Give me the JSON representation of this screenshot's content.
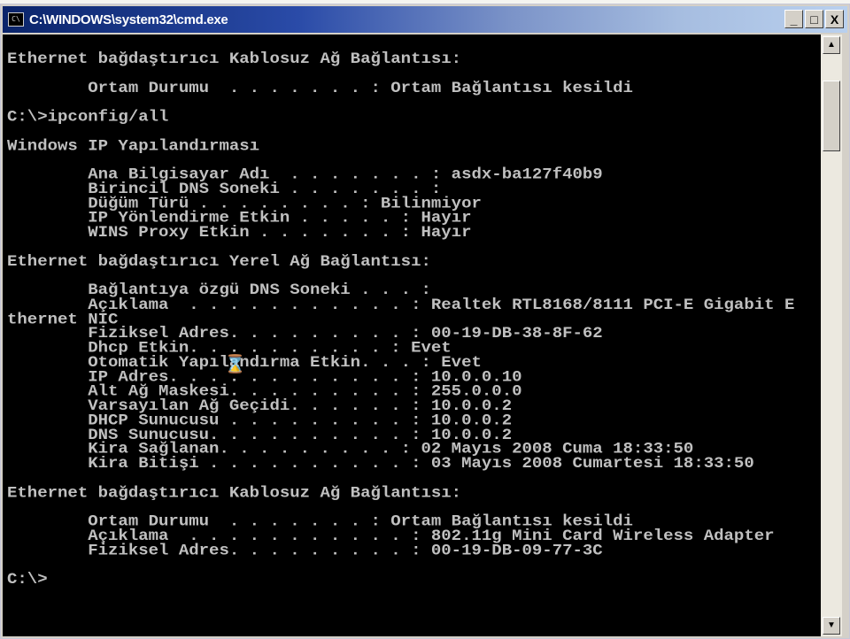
{
  "window": {
    "title": "C:\\WINDOWS\\system32\\cmd.exe",
    "icon": "cmd-icon",
    "controls": {
      "minimize": "_",
      "maximize": "□",
      "close": "X"
    }
  },
  "console": {
    "lines": [
      "Ethernet bağdaştırıcı Kablosuz Ağ Bağlantısı:",
      "",
      "        Ortam Durumu  . . . . . . . : Ortam Bağlantısı kesildi",
      "",
      "C:\\>ipconfig/all",
      "",
      "Windows IP Yapılandırması",
      "",
      "        Ana Bilgisayar Adı  . . . . . . . : asdx-ba127f40b9",
      "        Birincil DNS Soneki . . . . . . . :",
      "        Düğüm Türü . . . . . . . . : Bilinmiyor",
      "        IP Yönlendirme Etkin . . . . . : Hayır",
      "        WINS Proxy Etkin . . . . . . . : Hayır",
      "",
      "Ethernet bağdaştırıcı Yerel Ağ Bağlantısı:",
      "",
      "        Bağlantıya özgü DNS Soneki . . . :",
      "        Açıklama  . . . . . . . . . . . : Realtek RTL8168/8111 PCI-E Gigabit E",
      "thernet NIC",
      "        Fiziksel Adres. . . . . . . . . : 00-19-DB-38-8F-62",
      "        Dhcp Etkin. . . . . . . . . . : Evet",
      "        Otomatik Yapılandırma Etkin. . . : Evet",
      "        IP Adres. . . . . . . . . . . . : 10.0.0.10",
      "        Alt Ağ Maskesi. . . . . . . . . : 255.0.0.0",
      "        Varsayılan Ağ Geçidi. . . . . . : 10.0.0.2",
      "        DHCP Sunucusu . . . . . . . . . : 10.0.0.2",
      "        DNS Sunucusu. . . . . . . . . . : 10.0.0.2",
      "        Kira Sağlanan. . . . . . . . . : 02 Mayıs 2008 Cuma 18:33:50",
      "        Kira Bitişi . . . . . . . . . . : 03 Mayıs 2008 Cumartesi 18:33:50",
      "",
      "Ethernet bağdaştırıcı Kablosuz Ağ Bağlantısı:",
      "",
      "        Ortam Durumu  . . . . . . . : Ortam Bağlantısı kesildi",
      "        Açıklama  . . . . . . . . . . . : 802.11g Mini Card Wireless Adapter",
      "        Fiziksel Adres. . . . . . . . . : 00-19-DB-09-77-3C",
      "",
      "C:\\>"
    ]
  }
}
